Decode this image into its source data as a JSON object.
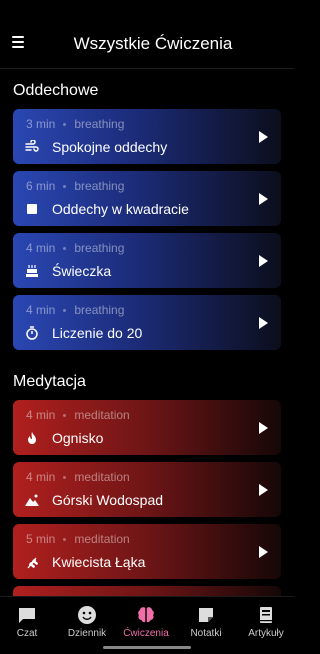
{
  "header": {
    "title": "Wszystkie Ćwiczenia"
  },
  "sections": [
    {
      "title": "Oddechowe",
      "color": "#2a47b3",
      "items": [
        {
          "duration": "3 min",
          "category": "breathing",
          "name": "Spokojne oddechy",
          "icon": "wind-icon"
        },
        {
          "duration": "6 min",
          "category": "breathing",
          "name": "Oddechy w kwadracie",
          "icon": "square-icon"
        },
        {
          "duration": "4 min",
          "category": "breathing",
          "name": "Świeczka",
          "icon": "cake-icon"
        },
        {
          "duration": "4 min",
          "category": "breathing",
          "name": "Liczenie do 20",
          "icon": "timer-icon"
        }
      ]
    },
    {
      "title": "Medytacja",
      "color": "#b0201e",
      "items": [
        {
          "duration": "4 min",
          "category": "meditation",
          "name": "Ognisko",
          "icon": "fire-icon"
        },
        {
          "duration": "4 min",
          "category": "meditation",
          "name": "Górski Wodospad",
          "icon": "landscape-icon"
        },
        {
          "duration": "5 min",
          "category": "meditation",
          "name": "Kwiecista Łąka",
          "icon": "grain-icon"
        }
      ]
    }
  ],
  "nav": {
    "active_color": "#f06fa8",
    "items": [
      {
        "label": "Czat",
        "icon": "chat-icon"
      },
      {
        "label": "Dziennik",
        "icon": "smiley-icon"
      },
      {
        "label": "Ćwiczenia",
        "icon": "brain-icon",
        "active": true
      },
      {
        "label": "Notatki",
        "icon": "note-icon"
      },
      {
        "label": "Artykuły",
        "icon": "book-icon"
      }
    ]
  }
}
